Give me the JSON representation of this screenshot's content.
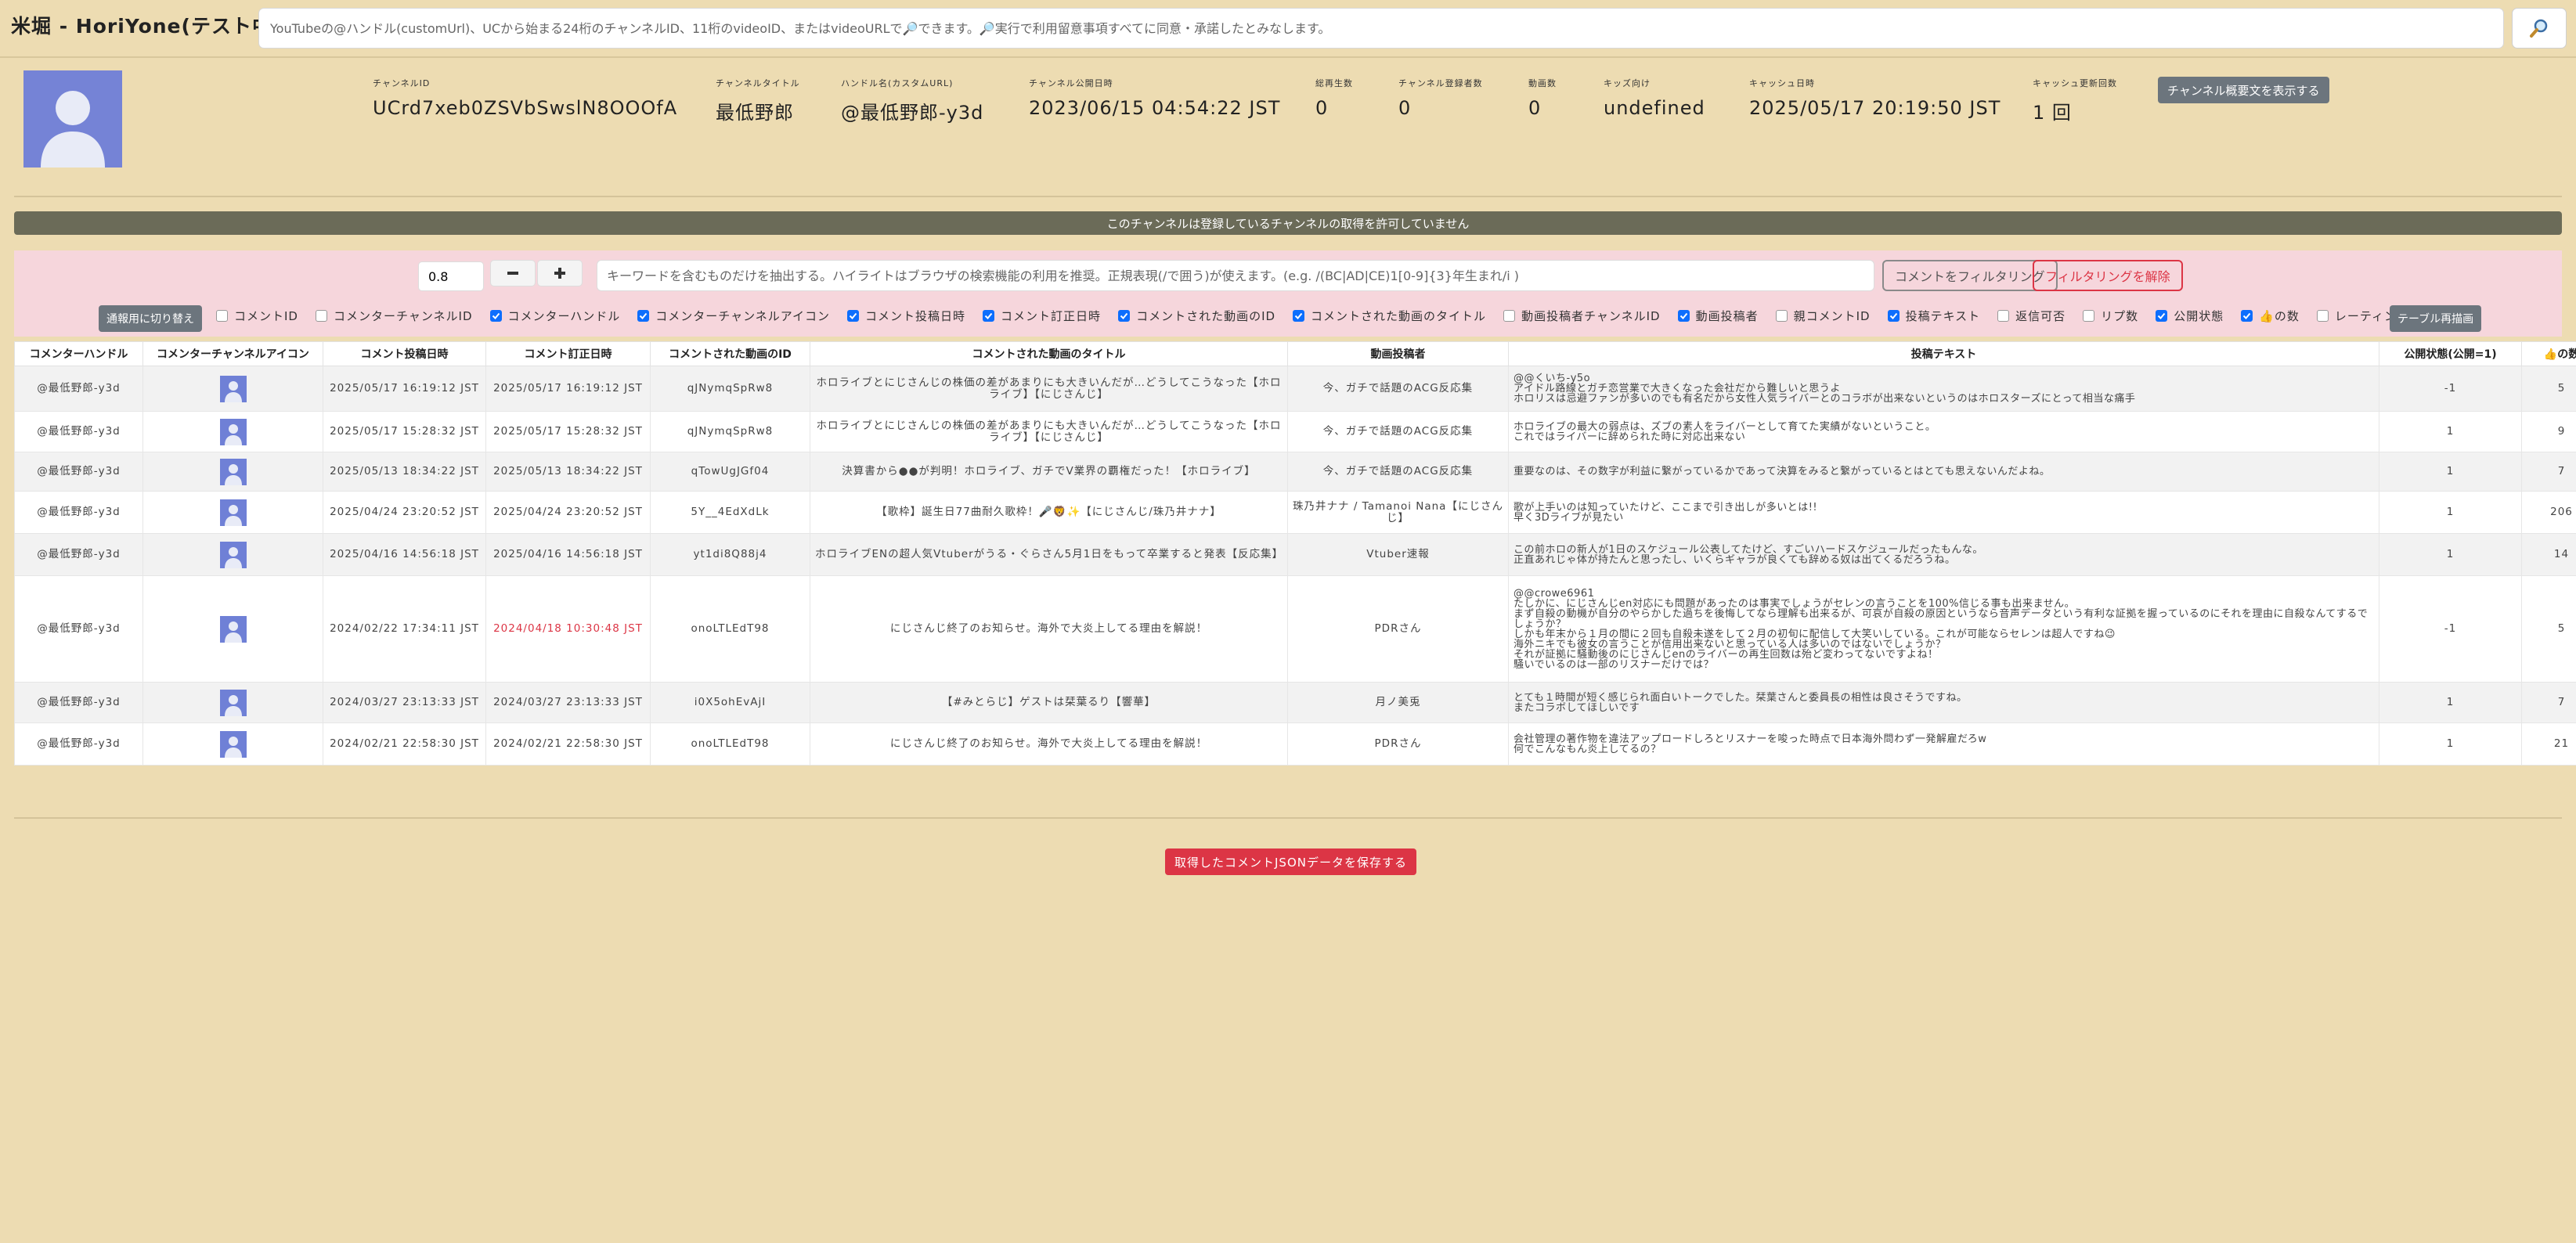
{
  "header": {
    "title": "米堀 - HoriYone(テスト中)",
    "search_placeholder": "YouTubeの@ハンドル(customUrl)、UCから始まる24桁のチャンネルID、11桁のvideoID、またはvideoURLで🔎できます。🔎実行で利用留意事項すべてに同意・承諾したとみなします。",
    "search_icon": "magnifier-icon"
  },
  "channel": {
    "avatar_icon": "default-user-avatar",
    "fields": [
      {
        "label": "チャンネルID",
        "value": "UCrd7xeb0ZSVbSwslN8OOOfA"
      },
      {
        "label": "チャンネルタイトル",
        "value": "最低野郎"
      },
      {
        "label": "ハンドル名(カスタムURL)",
        "value": "@最低野郎-y3d"
      },
      {
        "label": "チャンネル公開日時",
        "value": "2023/06/15 04:54:22 JST"
      },
      {
        "label": "総再生数",
        "value": "0"
      },
      {
        "label": "チャンネル登録者数",
        "value": "0"
      },
      {
        "label": "動画数",
        "value": "0"
      },
      {
        "label": "キッズ向け",
        "value": "undefined"
      },
      {
        "label": "キャッシュ日時",
        "value": "2025/05/17 20:19:50 JST"
      },
      {
        "label": "キャッシュ更新回数",
        "value": "1 回"
      }
    ],
    "summary_button": "チャンネル概要文を表示する"
  },
  "notice": "このチャンネルは登録しているチャンネルの取得を許可していません",
  "filter": {
    "zoom_value": "0.8",
    "zoom_minus_icon": "minus-icon",
    "zoom_plus_icon": "plus-icon",
    "keyword_placeholder": "キーワードを含むものだけを抽出する。ハイライトはブラウザの検索機能の利用を推奨。正規表現(/で囲う)が使えます。(e.g. /(BC|AD|CE)1[0-9]{3}年生まれ/i )",
    "apply_label": "コメントをフィルタリング",
    "clear_label": "フィルタリングを解除",
    "mode_toggle_label": "通報用に切り替え",
    "redraw_label": "テーブル再描画",
    "columns": [
      {
        "label": "コメントID",
        "checked": false
      },
      {
        "label": "コメンターチャンネルID",
        "checked": false
      },
      {
        "label": "コメンターハンドル",
        "checked": true
      },
      {
        "label": "コメンターチャンネルアイコン",
        "checked": true
      },
      {
        "label": "コメント投稿日時",
        "checked": true
      },
      {
        "label": "コメント訂正日時",
        "checked": true
      },
      {
        "label": "コメントされた動画のID",
        "checked": true
      },
      {
        "label": "コメントされた動画のタイトル",
        "checked": true
      },
      {
        "label": "動画投稿者チャンネルID",
        "checked": false
      },
      {
        "label": "動画投稿者",
        "checked": true
      },
      {
        "label": "親コメントID",
        "checked": false
      },
      {
        "label": "投稿テキスト",
        "checked": true
      },
      {
        "label": "返信可否",
        "checked": false
      },
      {
        "label": "リプ数",
        "checked": false
      },
      {
        "label": "公開状態",
        "checked": true
      },
      {
        "label": "👍の数",
        "checked": true
      },
      {
        "label": "レーティング",
        "checked": false
      }
    ]
  },
  "table": {
    "headers": [
      "コメンターハンドル",
      "コメンターチャンネルアイコン",
      "コメント投稿日時",
      "コメント訂正日時",
      "コメントされた動画のID",
      "コメントされた動画のタイトル",
      "動画投稿者",
      "投稿テキスト",
      "公開状態(公開=1)",
      "👍の数"
    ],
    "rows": [
      {
        "handle": "@最低野郎-y3d",
        "posted": "2025/05/17 16:19:12 JST",
        "edited": "2025/05/17 16:19:12 JST",
        "edited_red": false,
        "video_id": "qJNymqSpRw8",
        "video_title": "ホロライブとにじさんじの株価の差があまりにも大きいんだが…どうしてこうなった【ホロライブ】【にじさんじ】",
        "uploader": "今、ガチで話題のACG反応集",
        "text": "@@くいち-y5o\nアイドル路線とガチ恋営業で大きくなった会社だから難しいと思うよ\nホロリスは忌避ファンが多いのでも有名だから女性人気ライバーとのコラボが出来ないというのはホロスターズにとって相当な痛手",
        "status": "-1",
        "likes": "5"
      },
      {
        "handle": "@最低野郎-y3d",
        "posted": "2025/05/17 15:28:32 JST",
        "edited": "2025/05/17 15:28:32 JST",
        "edited_red": false,
        "video_id": "qJNymqSpRw8",
        "video_title": "ホロライブとにじさんじの株価の差があまりにも大きいんだが…どうしてこうなった【ホロライブ】【にじさんじ】",
        "uploader": "今、ガチで話題のACG反応集",
        "text": "ホロライブの最大の弱点は、ズブの素人をライバーとして育てた実績がないということ。\nこれではライバーに辞められた時に対応出来ない",
        "status": "1",
        "likes": "9"
      },
      {
        "handle": "@最低野郎-y3d",
        "posted": "2025/05/13 18:34:22 JST",
        "edited": "2025/05/13 18:34:22 JST",
        "edited_red": false,
        "video_id": "qTowUgJGf04",
        "video_title": "決算書から●●が判明！ホロライブ、ガチでV業界の覇権だった！【ホロライブ】",
        "uploader": "今、ガチで話題のACG反応集",
        "text": "重要なのは、その数字が利益に繋がっているかであって決算をみると繋がっているとはとても思えないんだよね。",
        "status": "1",
        "likes": "7"
      },
      {
        "handle": "@最低野郎-y3d",
        "posted": "2025/04/24 23:20:52 JST",
        "edited": "2025/04/24 23:20:52 JST",
        "edited_red": false,
        "video_id": "5Y__4EdXdLk",
        "video_title": "【歌枠】誕生日77曲耐久歌枠！🎤🦁✨【にじさんじ/珠乃井ナナ】",
        "uploader": "珠乃井ナナ / Tamanoi Nana【にじさんじ】",
        "text": "歌が上手いのは知っていたけど、ここまで引き出しが多いとは!!\n早く3Dライブが見たい",
        "status": "1",
        "likes": "206"
      },
      {
        "handle": "@最低野郎-y3d",
        "posted": "2025/04/16 14:56:18 JST",
        "edited": "2025/04/16 14:56:18 JST",
        "edited_red": false,
        "video_id": "yt1di8Q88j4",
        "video_title": "ホロライブENの超人気Vtuberがうる・ぐらさん5月1日をもって卒業すると発表【反応集】",
        "uploader": "Vtuber速報",
        "text": "この前ホロの新人が1日のスケジュール公表してたけど、すごいハードスケジュールだったもんな。\n正直あれじゃ体が持たんと思ったし、いくらギャラが良くても辞める奴は出てくるだろうね。",
        "status": "1",
        "likes": "14"
      },
      {
        "handle": "@最低野郎-y3d",
        "posted": "2024/02/22 17:34:11 JST",
        "edited": "2024/04/18 10:30:48 JST",
        "edited_red": true,
        "video_id": "onoLTLEdT98",
        "video_title": "にじさんじ終了のお知らせ。海外で大炎上してる理由を解説！",
        "uploader": "PDRさん",
        "text": "@@crowe6961\nたしかに、にじさんじen対応にも問題があったのは事実でしょうがセレンの言うことを100%信じる事も出来ません。\nまず自殺の動機が自分のやらかした過ちを後悔してなら理解も出来るが、可哀が自殺の原因というなら音声データという有利な証拠を握っているのにそれを理由に自殺なんてするでしょうか？\nしかも年末から１月の間に２回も自殺未遂をして２月の初旬に配信して大笑いしている。これが可能ならセレンは超人ですね😉\n海外ニキでも彼女の言うことが信用出来ないと思っている人は多いのではないでしょうか？\nそれが証拠に騒動後のにじさんじenのライバーの再生回数は殆ど変わってないですよね！\n騒いでいるのは一部のリスナーだけでは？",
        "status": "-1",
        "likes": "5"
      },
      {
        "handle": "@最低野郎-y3d",
        "posted": "2024/03/27 23:13:33 JST",
        "edited": "2024/03/27 23:13:33 JST",
        "edited_red": false,
        "video_id": "i0X5ohEvAjI",
        "video_title": "【#みとらじ】ゲストは栞葉るり【響華】",
        "uploader": "月ノ美兎",
        "text": "とても１時間が短く感じられ面白いトークでした。栞葉さんと委員長の相性は良さそうですね。\nまたコラボしてほしいです",
        "status": "1",
        "likes": "7"
      },
      {
        "handle": "@最低野郎-y3d",
        "posted": "2024/02/21 22:58:30 JST",
        "edited": "2024/02/21 22:58:30 JST",
        "edited_red": false,
        "video_id": "onoLTLEdT98",
        "video_title": "にじさんじ終了のお知らせ。海外で大炎上してる理由を解説！",
        "uploader": "PDRさん",
        "text": "会社管理の著作物を違法アップロードしろとリスナーを唆った時点で日本海外問わず一発解雇だろw\n何でこんなもん炎上してるの？",
        "status": "1",
        "likes": "21"
      }
    ]
  },
  "save_button": "取得したコメントJSONデータを保存する"
}
